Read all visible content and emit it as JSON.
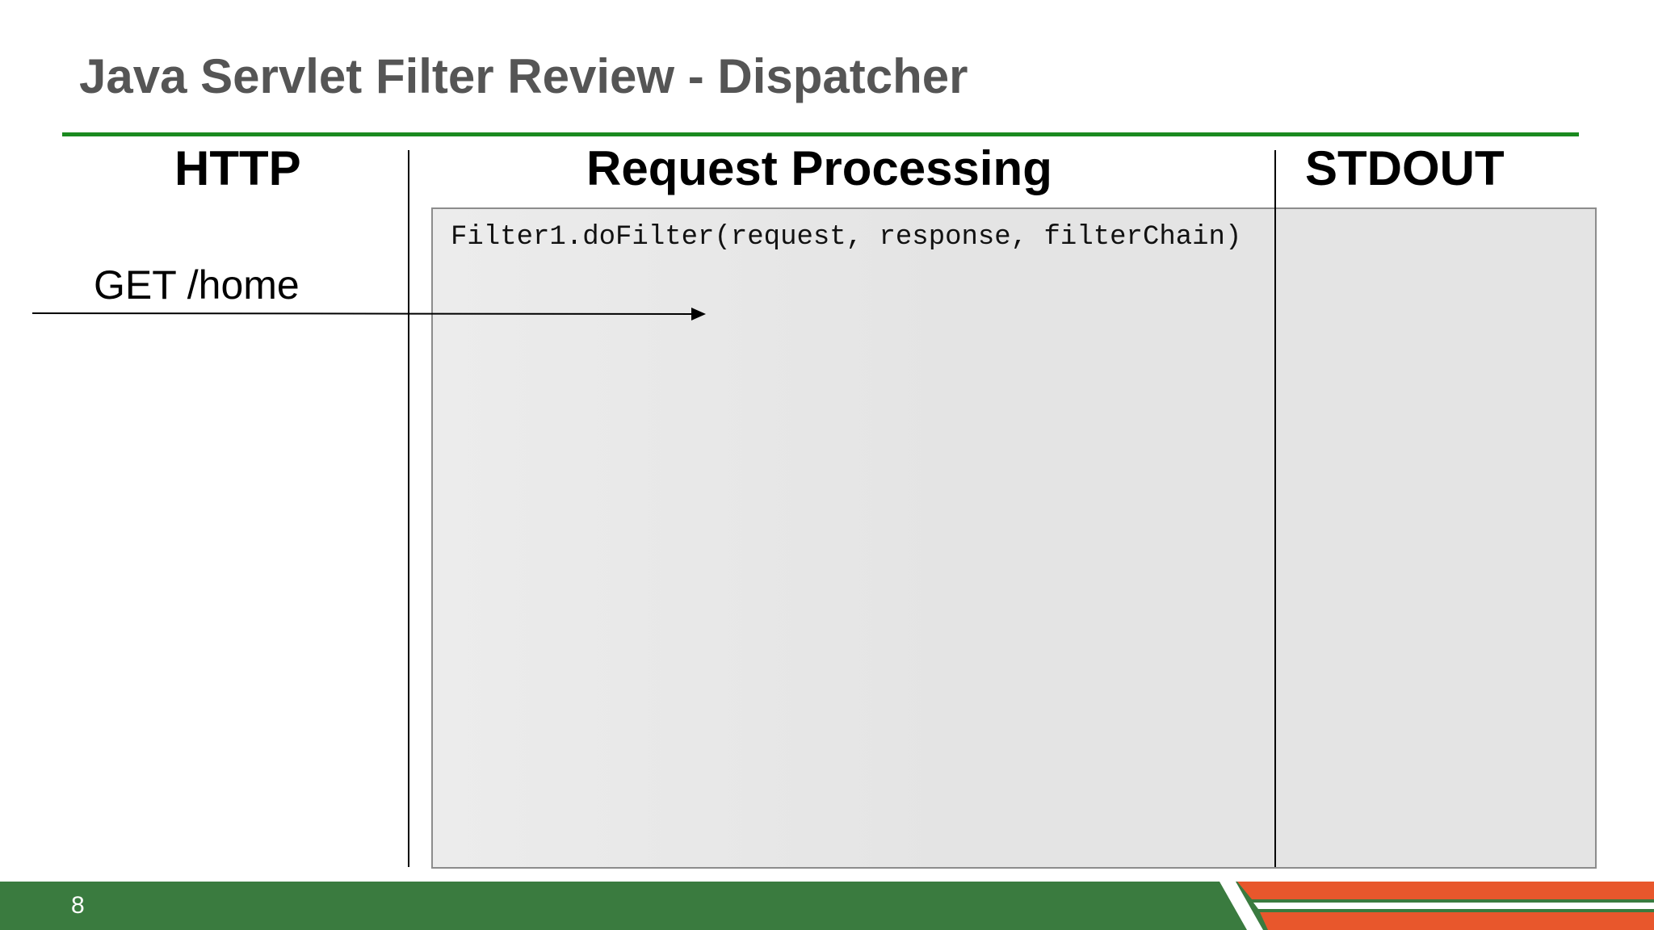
{
  "slide": {
    "title": "Java Servlet Filter Review - Dispatcher",
    "page_number": "8"
  },
  "columns": {
    "http": "HTTP",
    "request_processing": "Request Processing",
    "stdout": "STDOUT"
  },
  "request": {
    "label": "GET /home"
  },
  "processing": {
    "call": "Filter1.doFilter(request, response, filterChain)"
  },
  "colors": {
    "title_rule": "#1a8a1f",
    "footer_green": "#3a7b3f",
    "footer_orange": "#e8572c"
  }
}
